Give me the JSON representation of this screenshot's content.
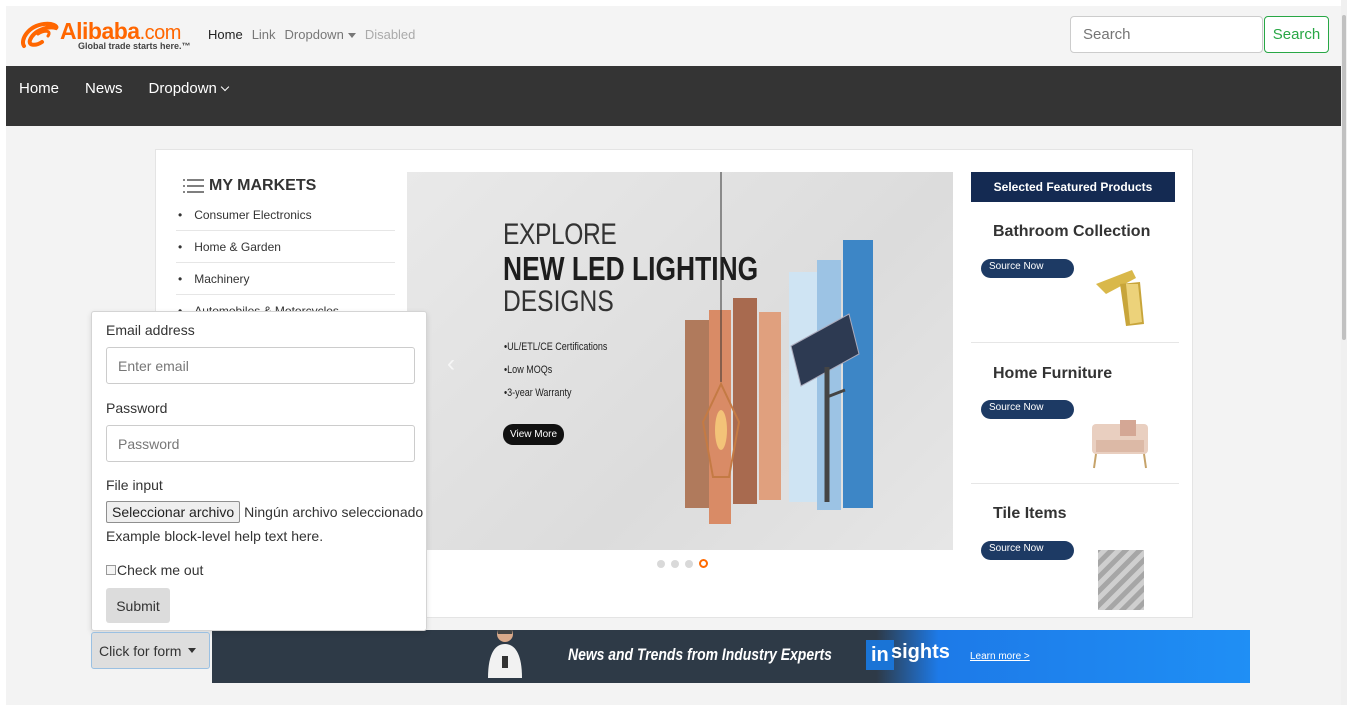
{
  "topnav": {
    "logo_brand": "Alibaba",
    "logo_com": ".com",
    "logo_tagline": "Global trade starts here.™",
    "links": [
      "Home",
      "Link",
      "Dropdown",
      "Disabled"
    ],
    "search_placeholder": "Search",
    "search_button": "Search"
  },
  "darknav": {
    "items": [
      "Home",
      "News",
      "Dropdown"
    ]
  },
  "markets": {
    "title": "MY MARKETS",
    "items": [
      "Consumer Electronics",
      "Home & Garden",
      "Machinery",
      "Automobiles & Motorcycles"
    ]
  },
  "banner": {
    "line1": "EXPLORE",
    "line2": "NEW LED LIGHTING",
    "line3": "DESIGNS",
    "bullets": [
      "•UL/ETL/CE Certifications",
      "•Low MOQs",
      "•3-year Warranty"
    ],
    "cta": "View More",
    "slide_count": 4,
    "active_slide": 4
  },
  "featured": {
    "heading": "Selected Featured Products",
    "products": [
      {
        "title": "Bathroom Collection",
        "button": "Source Now"
      },
      {
        "title": "Home Furniture",
        "button": "Source Now"
      },
      {
        "title": "Tile Items",
        "button": "Source Now"
      }
    ]
  },
  "form": {
    "email_label": "Email address",
    "email_placeholder": "Enter email",
    "password_label": "Password",
    "password_placeholder": "Password",
    "file_label": "File input",
    "file_button": "Seleccionar archivo",
    "file_status": "Ningún archivo seleccionado",
    "help_text": "Example block-level help text here.",
    "check_label": "Check me out",
    "submit": "Submit",
    "toggle": "Click for form"
  },
  "insights": {
    "headline": "News and Trends from Industry Experts",
    "logo_in": "in",
    "logo_sights": "sights",
    "link": "Learn more >"
  },
  "colors": {
    "brand": "#ff6600",
    "dark_nav": "#343434",
    "featured_head": "#142a52",
    "success": "#28a745"
  }
}
